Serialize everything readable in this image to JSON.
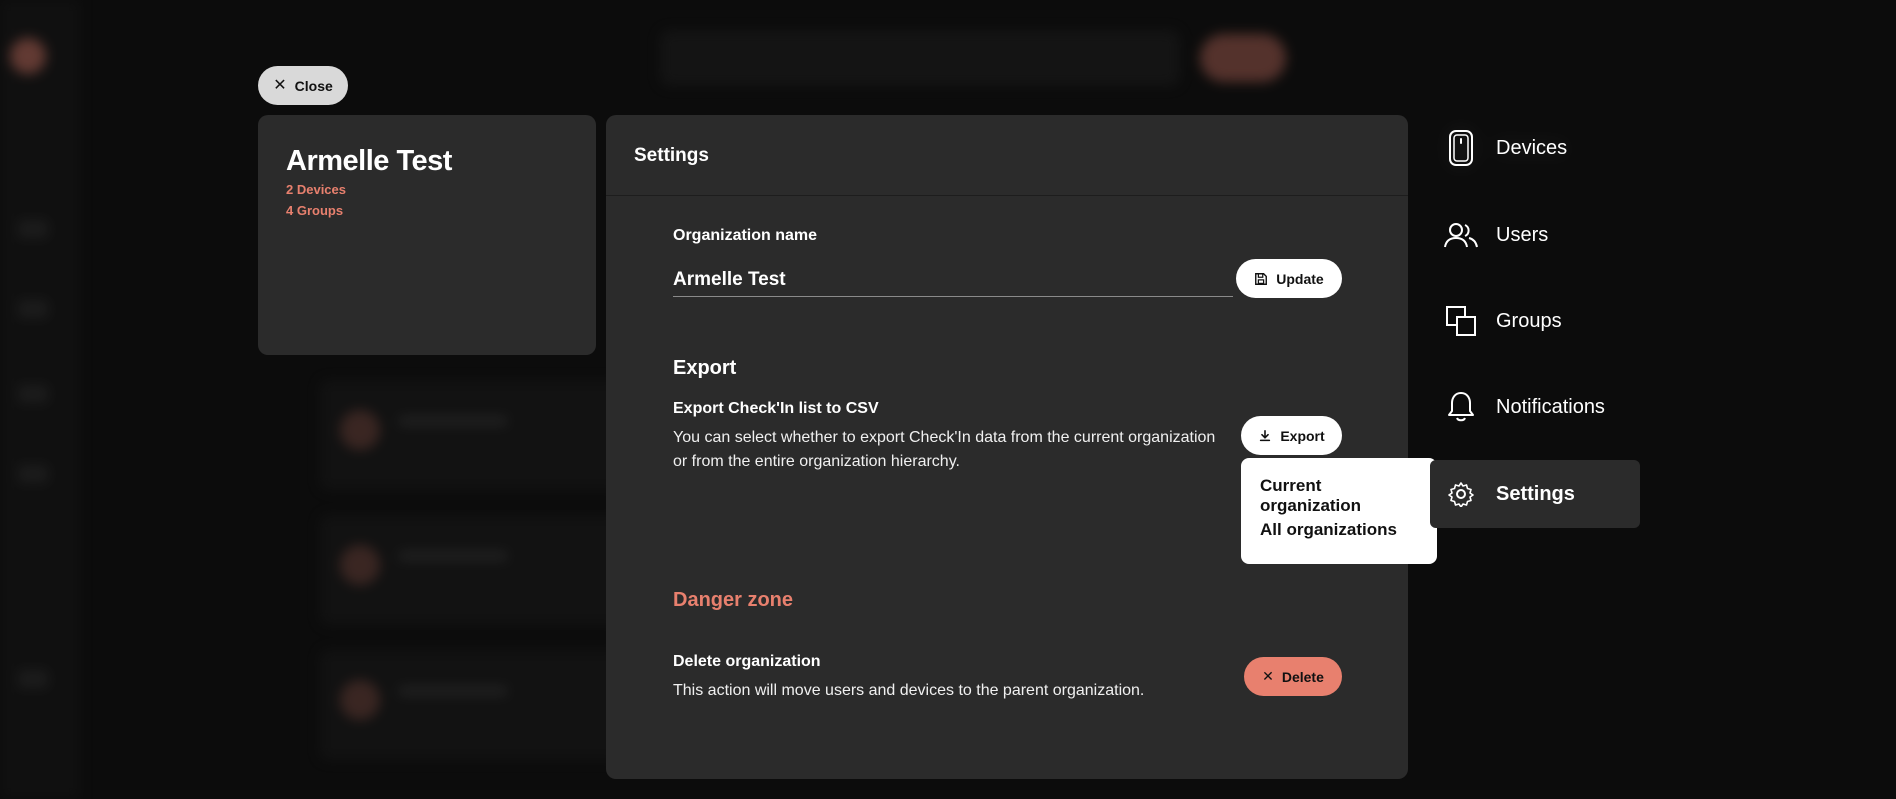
{
  "close_label": "Close",
  "org": {
    "name": "Armelle Test",
    "devices": "2 Devices",
    "groups": "4 Groups"
  },
  "settings": {
    "title": "Settings",
    "org_name_label": "Organization name",
    "org_name_value": "Armelle Test",
    "update_label": "Update",
    "export_heading": "Export",
    "export_title": "Export Check'In list to CSV",
    "export_desc_1": "You can select whether to export Check'In data from the current organization",
    "export_desc_2": "or from the entire organization hierarchy.",
    "export_label": "Export",
    "danger_heading": "Danger zone",
    "delete_title": "Delete organization",
    "delete_desc": "This action will move users and devices to the parent organization.",
    "delete_label": "Delete"
  },
  "export_menu": {
    "options": [
      "Current organization",
      "All organizations"
    ]
  },
  "right_nav": [
    {
      "label": "Devices",
      "icon": "phone-icon"
    },
    {
      "label": "Users",
      "icon": "users-icon"
    },
    {
      "label": "Groups",
      "icon": "groups-icon"
    },
    {
      "label": "Notifications",
      "icon": "bell-icon"
    },
    {
      "label": "Settings",
      "icon": "gear-icon",
      "active": true
    }
  ],
  "colors": {
    "accent": "#e8806e",
    "card": "#2b2b2b",
    "background": "#0c0c0c"
  }
}
